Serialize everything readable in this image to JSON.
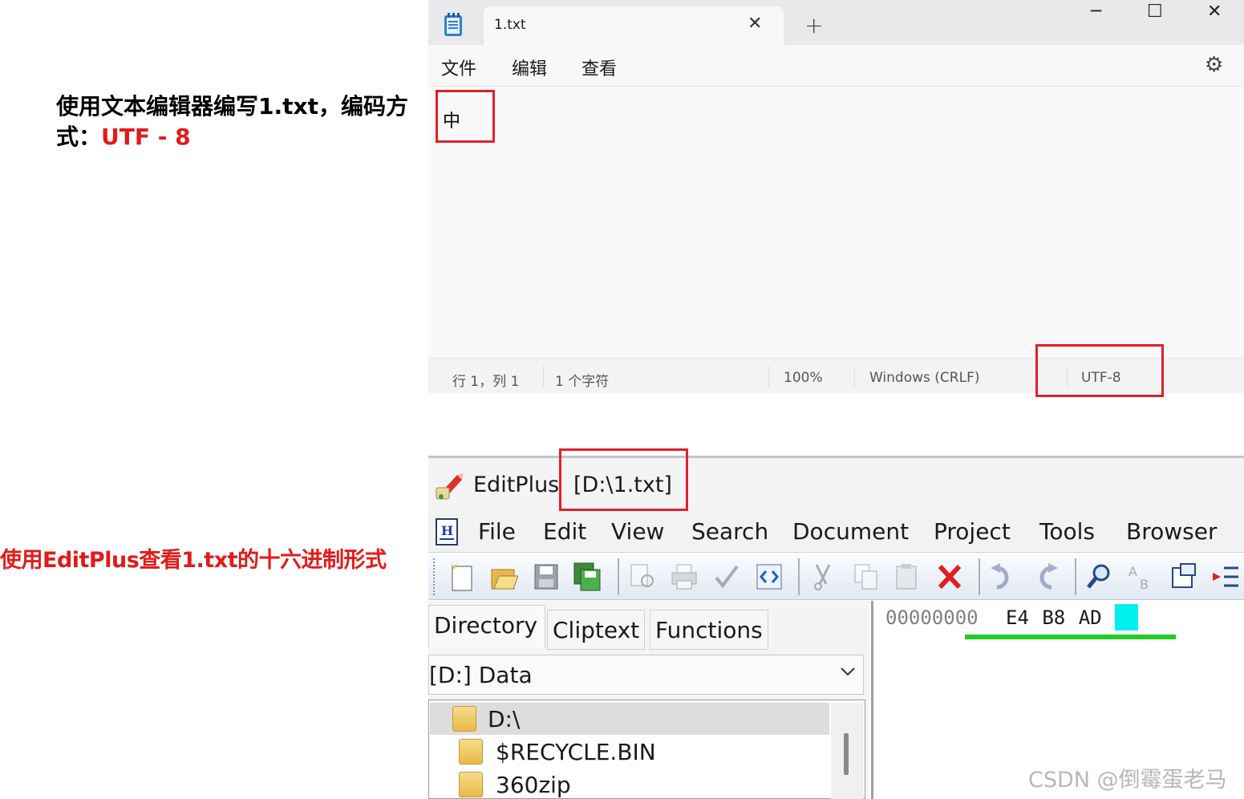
{
  "annotations": {
    "notepad_note_prefix": "使用文本编辑器编写1.txt，编码方式：",
    "notepad_note_encoding": "UTF - 8",
    "editplus_note": "使用EditPlus查看1.txt的十六进制形式"
  },
  "notepad": {
    "tab_label": "1.txt",
    "close_tab_glyph": "✕",
    "new_tab_glyph": "+",
    "window_controls": {
      "minimize": "─",
      "maximize": "☐",
      "close": "✕"
    },
    "menu": [
      "文件",
      "编辑",
      "查看"
    ],
    "settings_glyph": "⚙",
    "content": "中",
    "status": {
      "position": "行 1，列 1",
      "char_count": "1 个字符",
      "zoom": "100%",
      "line_ending": "Windows (CRLF)",
      "encoding": "UTF-8"
    }
  },
  "editplus": {
    "app_name": "EditPlus",
    "file_path": "[D:\\1.txt]",
    "menu": [
      "File",
      "Edit",
      "View",
      "Search",
      "Document",
      "Project",
      "Tools",
      "Browser"
    ],
    "side_tabs": [
      "Directory",
      "Cliptext",
      "Functions"
    ],
    "drive_select": "[D:] Data",
    "tree": [
      "D:\\",
      "$RECYCLE.BIN",
      "360zip"
    ],
    "hex": {
      "address": "00000000",
      "bytes": "E4  B8  AD"
    }
  },
  "watermark": "CSDN @倒霉蛋老马"
}
